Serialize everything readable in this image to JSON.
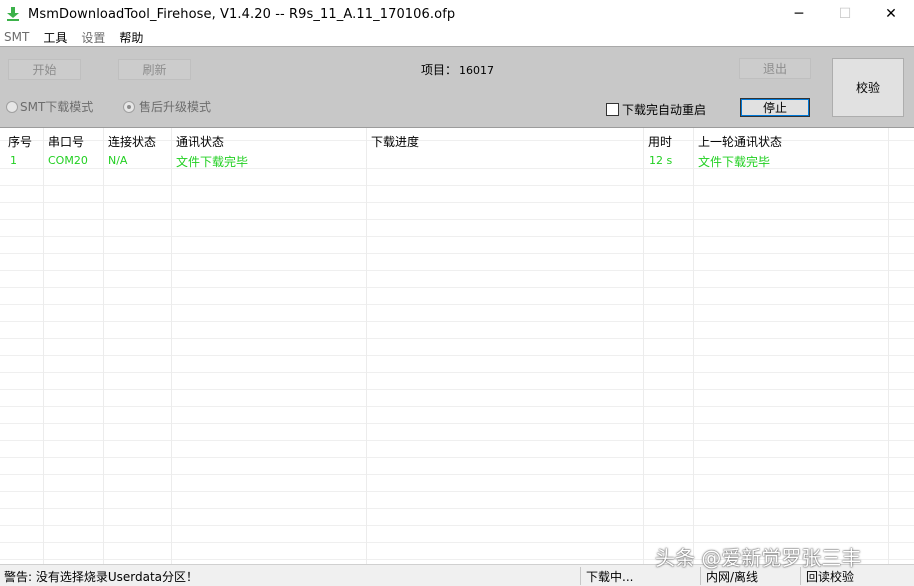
{
  "window": {
    "title": "MsmDownloadTool_Firehose, V1.4.20 -- R9s_11_A.11_170106.ofp",
    "minimize_glyph": "─",
    "maximize_glyph": "☐",
    "close_glyph": "✕",
    "icon": "download-arrow-icon",
    "icon_color": "#3cb24a"
  },
  "menu": {
    "items": [
      {
        "label": "SMT"
      },
      {
        "label": "工具"
      },
      {
        "label": "设置"
      },
      {
        "label": "帮助"
      }
    ]
  },
  "panel": {
    "start_label": "开始",
    "refresh_label": "刷新",
    "project_label": "项目：",
    "project_number": "16017",
    "exit_label": "退出",
    "verify_label": "校验",
    "smt_mode_label": "SMT下载模式",
    "after_sales_mode_label": "售后升级模式",
    "auto_restart_label": "下载完自动重启",
    "stop_label": "停止"
  },
  "table": {
    "columns": [
      "序号",
      "串口号",
      "连接状态",
      "通讯状态",
      "下载进度",
      "用时",
      "上一轮通讯状态"
    ],
    "rows": [
      {
        "index": "1",
        "port": "COM20",
        "connection": "N/A",
        "comm_status": "文件下载完毕",
        "progress": "",
        "time": "12 s",
        "last_status": "文件下载完毕"
      }
    ],
    "row_text_color": "#22d022"
  },
  "statusbar": {
    "warning": "警告: 没有选择烧录Userdata分区！",
    "download_status": "下载中...",
    "network": "内网/离线",
    "readback": "回读校验"
  },
  "watermark": {
    "text": "头条 @爱新觉罗张三丰"
  }
}
